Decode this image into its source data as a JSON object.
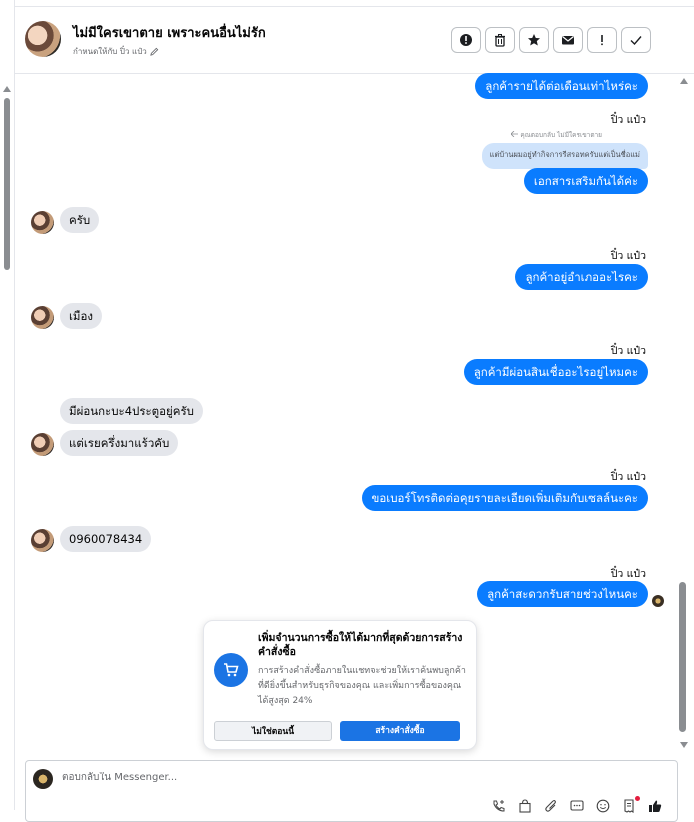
{
  "header": {
    "title": "ไม่มีใครเขาตาย เพราะคนอื่นไม่รัก",
    "subtitle": "กำหนดให้กับ ปิ๋ว แป๋ว",
    "actions": [
      {
        "name": "alert-icon"
      },
      {
        "name": "trash-icon"
      },
      {
        "name": "star-icon"
      },
      {
        "name": "mail-icon"
      },
      {
        "name": "exclamation-icon"
      },
      {
        "name": "check-icon"
      }
    ]
  },
  "messages": {
    "m1": "ลูกค้ารายได้ต่อเดือนเท่าไหร่คะ",
    "sender1": "ปิ๋ว แป๋ว",
    "reply_meta": "คุณตอบกลับ ไม่มีใครเขาตาย",
    "reply_quote": "แต่บ้านผมอยู่ทำกิจการรีสรอทครับแต่เป็นชื่อแม่",
    "m2": "เอกสารเสริมกันได้ค่ะ",
    "m3": "ครับ",
    "sender2": "ปิ๋ว แป๋ว",
    "m4": "ลูกค้าอยู่อำเภออะไรคะ",
    "m5": "เมือง",
    "sender3": "ปิ๋ว แป๋ว",
    "m6": "ลูกค้ามีผ่อนสินเชื่ออะไรอยู่ไหมคะ",
    "m7": "มีผ่อนกะบะ4ประตูอยู่ครับ",
    "m8": "แต่เรยครึ่งมาแร้วคับ",
    "sender4": "ปิ๋ว แป๋ว",
    "m9": "ขอเบอร์โทรติดต่อคุยรายละเอียดเพิ่มเติมกับเซลล์นะคะ",
    "m10": "0960078434",
    "sender5": "ปิ๋ว แป๋ว",
    "m11": "ลูกค้าสะดวกรับสายช่วงไหนคะ"
  },
  "promo": {
    "title": "เพิ่มจำนวนการซื้อให้ได้มากที่สุดด้วยการสร้างคำสั่งซื้อ",
    "body": "การสร้างคำสั่งซื้อภายในแชทจะช่วยให้เราค้นพบลูกค้าที่ดียิ่งขึ้นสำหรับธุรกิจของคุณ และเพิ่มการซื้อของคุณได้สูงสุด 24%",
    "secondary": "ไม่ใช่ตอนนี้",
    "primary": "สร้างคำสั่งซื้อ",
    "icon": "cart-icon"
  },
  "composer": {
    "placeholder": "ตอบกลับใน Messenger..."
  },
  "colors": {
    "outgoing": "#0a7cff",
    "incoming": "#e4e6eb",
    "primary_button": "#1b74e4"
  }
}
